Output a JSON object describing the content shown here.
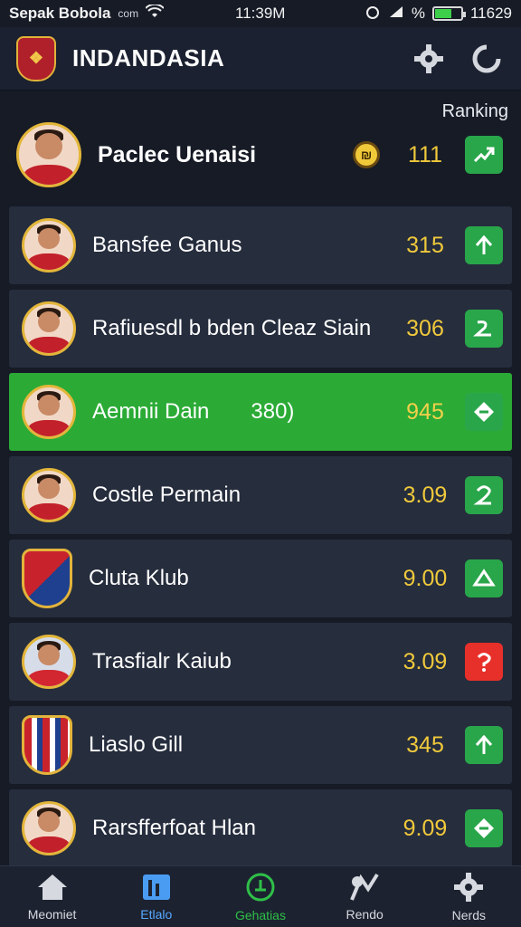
{
  "status_bar": {
    "app_name": "Sepak Bobola",
    "carrier": "com",
    "time": "11:39M",
    "battery_text": "%",
    "extra": "11629"
  },
  "header": {
    "title": "INDANDASIA",
    "crest_text": "❖"
  },
  "ranking_label": "Ranking",
  "top_player": {
    "name": "Paclec Uenaisi",
    "coin_symbol": "₪",
    "score": "111"
  },
  "rows": [
    {
      "name": "Bansfee Ganus",
      "score": "315",
      "type": "player",
      "button_icon": "arrow-up-icon",
      "button_color": "#29a64a"
    },
    {
      "name": "Rafiuesdl b bden Cleaz Siain",
      "score": "306",
      "type": "player",
      "button_icon": "curve-icon",
      "button_color": "#29a64a"
    },
    {
      "name": "Aemnii Dain",
      "extra": "380)",
      "score": "945",
      "type": "player",
      "highlight": true,
      "button_icon": "diamond-icon",
      "button_color": "#29a64a"
    },
    {
      "name": "Costle Permain",
      "score": "3.09",
      "type": "player",
      "button_icon": "two-icon",
      "button_color": "#29a64a"
    },
    {
      "name": "Cluta Klub",
      "score": "9.00",
      "type": "club",
      "button_icon": "triangle-icon",
      "button_color": "#29a64a"
    },
    {
      "name": "Trasfialr Kaiub",
      "score": "3.09",
      "type": "player",
      "button_icon": "question-icon",
      "button_color": "#e8302a"
    },
    {
      "name": "Liaslo Gill",
      "score": "345",
      "type": "club",
      "button_icon": "arrow-up-icon",
      "button_color": "#29a64a"
    },
    {
      "name": "Rarsfferfoat Hlan",
      "score": "9.09",
      "type": "player",
      "button_icon": "diamond-icon",
      "button_color": "#29a64a"
    }
  ],
  "bottom_nav": [
    {
      "label": "Meomiet",
      "icon": "home-icon"
    },
    {
      "label": "Etlalo",
      "icon": "stats-icon",
      "active": true
    },
    {
      "label": "Gehatias",
      "icon": "target-icon",
      "center": true
    },
    {
      "label": "Rendo",
      "icon": "chart-icon"
    },
    {
      "label": "Nerds",
      "icon": "gear-icon"
    }
  ]
}
